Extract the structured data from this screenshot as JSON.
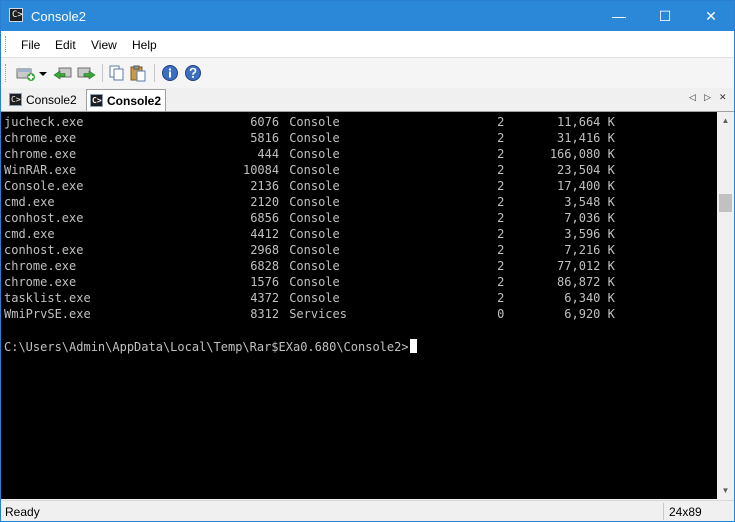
{
  "window": {
    "title": "Console2",
    "icon": "console-app-icon",
    "icon_glyph": "C>",
    "controls": {
      "minimize": "—",
      "maximize": "☐",
      "close": "✕"
    }
  },
  "menu": [
    "File",
    "Edit",
    "View",
    "Help"
  ],
  "toolbar": {
    "buttons": [
      "new-tab-icon",
      "dropdown-arrow-icon",
      "back-icon",
      "forward-icon",
      "copy-icon",
      "paste-icon",
      "info-icon",
      "help-icon"
    ]
  },
  "tabs": [
    {
      "label": "Console2",
      "active": false
    },
    {
      "label": "Console2",
      "active": true
    }
  ],
  "tab_nav": {
    "prev": "◁",
    "next": "▷",
    "close": "✕"
  },
  "console": {
    "rows": [
      {
        "name": "jucheck.exe",
        "pid": "6076",
        "session": "Console",
        "num": "2",
        "mem": "11,664 K"
      },
      {
        "name": "chrome.exe",
        "pid": "5816",
        "session": "Console",
        "num": "2",
        "mem": "31,416 K"
      },
      {
        "name": "chrome.exe",
        "pid": "444",
        "session": "Console",
        "num": "2",
        "mem": "166,080 K"
      },
      {
        "name": "WinRAR.exe",
        "pid": "10084",
        "session": "Console",
        "num": "2",
        "mem": "23,504 K"
      },
      {
        "name": "Console.exe",
        "pid": "2136",
        "session": "Console",
        "num": "2",
        "mem": "17,400 K"
      },
      {
        "name": "cmd.exe",
        "pid": "2120",
        "session": "Console",
        "num": "2",
        "mem": "3,548 K"
      },
      {
        "name": "conhost.exe",
        "pid": "6856",
        "session": "Console",
        "num": "2",
        "mem": "7,036 K"
      },
      {
        "name": "cmd.exe",
        "pid": "4412",
        "session": "Console",
        "num": "2",
        "mem": "3,596 K"
      },
      {
        "name": "conhost.exe",
        "pid": "2968",
        "session": "Console",
        "num": "2",
        "mem": "7,216 K"
      },
      {
        "name": "chrome.exe",
        "pid": "6828",
        "session": "Console",
        "num": "2",
        "mem": "77,012 K"
      },
      {
        "name": "chrome.exe",
        "pid": "1576",
        "session": "Console",
        "num": "2",
        "mem": "86,872 K"
      },
      {
        "name": "tasklist.exe",
        "pid": "4372",
        "session": "Console",
        "num": "2",
        "mem": "6,340 K"
      },
      {
        "name": "WmiPrvSE.exe",
        "pid": "8312",
        "session": "Services",
        "num": "0",
        "mem": "6,920 K"
      }
    ],
    "prompt": "C:\\Users\\Admin\\AppData\\Local\\Temp\\Rar$EXa0.680\\Console2>"
  },
  "status": {
    "text": "Ready",
    "dimensions": "24x89"
  },
  "colors": {
    "titlebar": "#2b88d8",
    "console_bg": "#000000",
    "console_fg": "#c0c0c0"
  }
}
